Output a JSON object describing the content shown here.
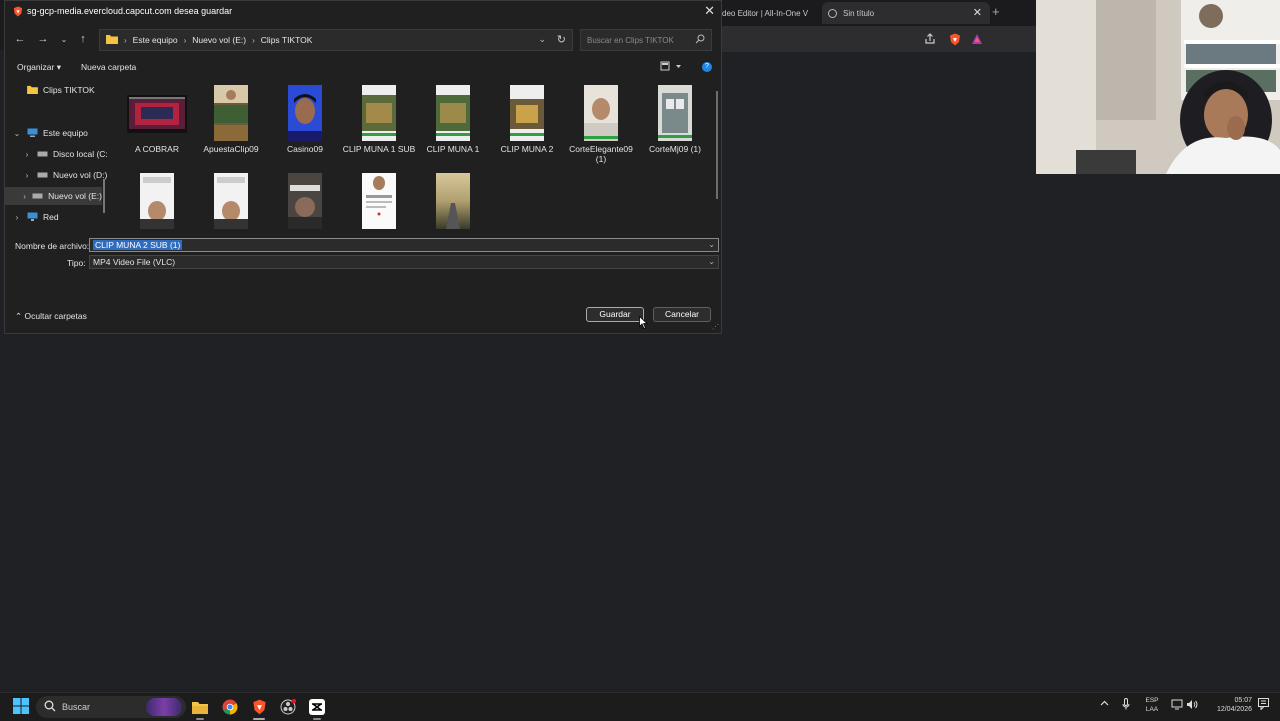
{
  "browser": {
    "tabs": [
      {
        "label": "deo Editor | All-In-One V"
      },
      {
        "label": "Sin título"
      }
    ]
  },
  "dialog": {
    "title": "sg-gcp-media.evercloud.capcut.com desea guardar",
    "breadcrumb": [
      "Este equipo",
      "Nuevo vol (E:)",
      "Clips TIKTOK"
    ],
    "search_placeholder": "Buscar en Clips TIKTOK",
    "organize_label": "Organizar",
    "new_folder_label": "Nueva carpeta",
    "nav_items": [
      {
        "label": "Clips TIKTOK",
        "icon": "folder-icon"
      },
      {
        "label": "Este equipo",
        "icon": "computer-icon",
        "expanded": true
      },
      {
        "label": "Disco local (C:",
        "icon": "drive-icon"
      },
      {
        "label": "Nuevo vol (D:)",
        "icon": "drive-icon"
      },
      {
        "label": "Nuevo vol (E:)",
        "icon": "drive-icon",
        "selected": true
      },
      {
        "label": "Red",
        "icon": "network-icon"
      }
    ],
    "files": [
      {
        "name": "A COBRAR"
      },
      {
        "name": "ApuestaClip09"
      },
      {
        "name": "Casino09"
      },
      {
        "name": "CLIP MUNA 1 SUB"
      },
      {
        "name": "CLIP MUNA 1"
      },
      {
        "name": "CLIP MUNA 2"
      },
      {
        "name": "CorteElegante09 (1)"
      },
      {
        "name": "CorteMj09 (1)"
      },
      {
        "name": ""
      },
      {
        "name": ""
      },
      {
        "name": ""
      },
      {
        "name": ""
      },
      {
        "name": ""
      }
    ],
    "filename_label": "Nombre de archivo:",
    "filename_value": "CLIP MUNA 2 SUB (1)",
    "type_label": "Tipo:",
    "type_value": "MP4 Video File (VLC)",
    "hide_folders_label": "Ocultar carpetas",
    "save_label": "Guardar",
    "cancel_label": "Cancelar"
  },
  "taskbar": {
    "search_label": "Buscar",
    "language_lines": [
      "ESP",
      "LAA"
    ],
    "time": "05:07",
    "date": "12/04/2026"
  },
  "colors": {
    "dialog_bg": "#202020",
    "selection": "#2d6cc0",
    "taskbar_bg": "#1c1c1c"
  }
}
